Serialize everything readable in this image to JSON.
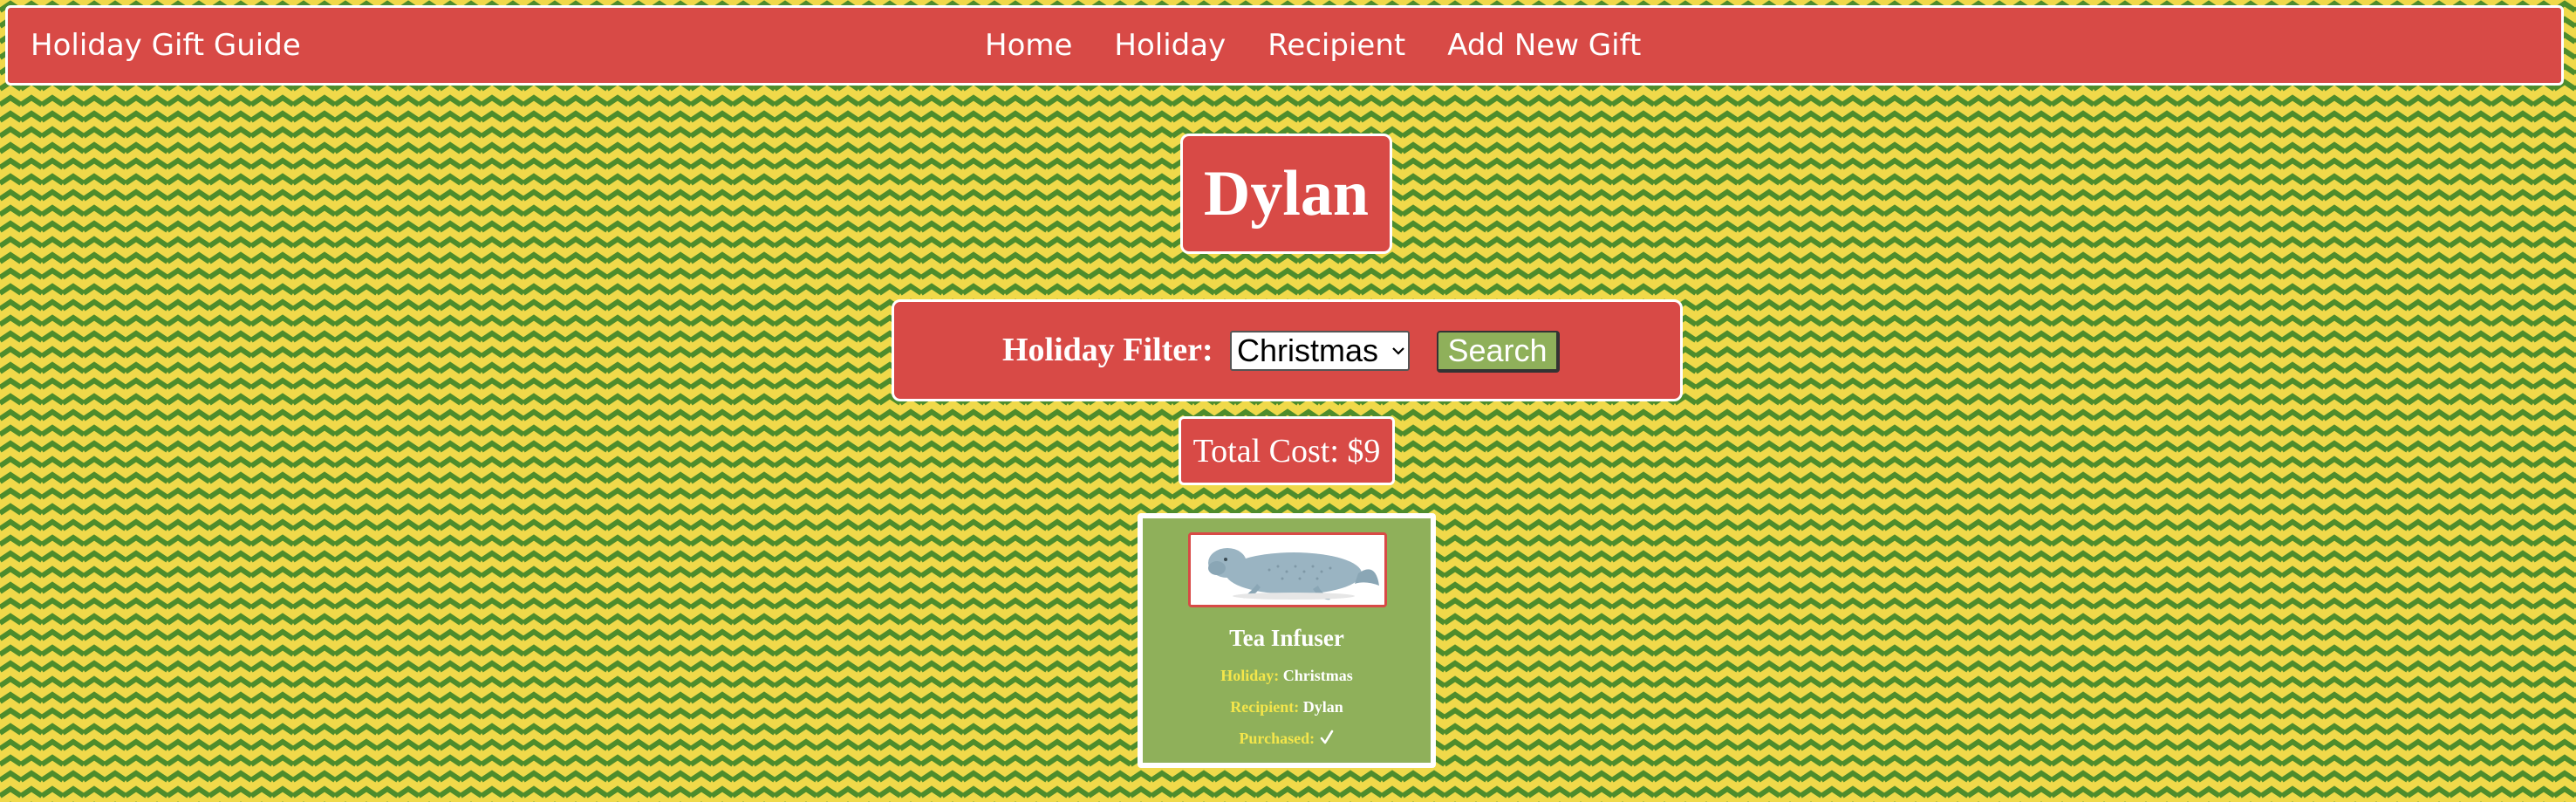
{
  "navbar": {
    "brand": "Holiday Gift Guide",
    "links": [
      "Home",
      "Holiday",
      "Recipient",
      "Add New Gift"
    ]
  },
  "page": {
    "title": "Dylan"
  },
  "filter": {
    "label": "Holiday Filter:",
    "selected": "Christmas",
    "search_label": "Search"
  },
  "total": {
    "label": "Total Cost: $9"
  },
  "gifts": [
    {
      "name": "Tea Infuser",
      "holiday_label": "Holiday:",
      "holiday": "Christmas",
      "recipient_label": "Recipient:",
      "recipient": "Dylan",
      "purchased_label": "Purchased:",
      "purchased": true,
      "image_icon": "manatee-tea-infuser-icon"
    }
  ],
  "colors": {
    "accent_red": "#d84a46",
    "card_green": "#8fb05a",
    "pattern_green": "#4e8c2c",
    "pattern_yellow": "#f0d94a",
    "label_yellow": "#f4e64a"
  }
}
